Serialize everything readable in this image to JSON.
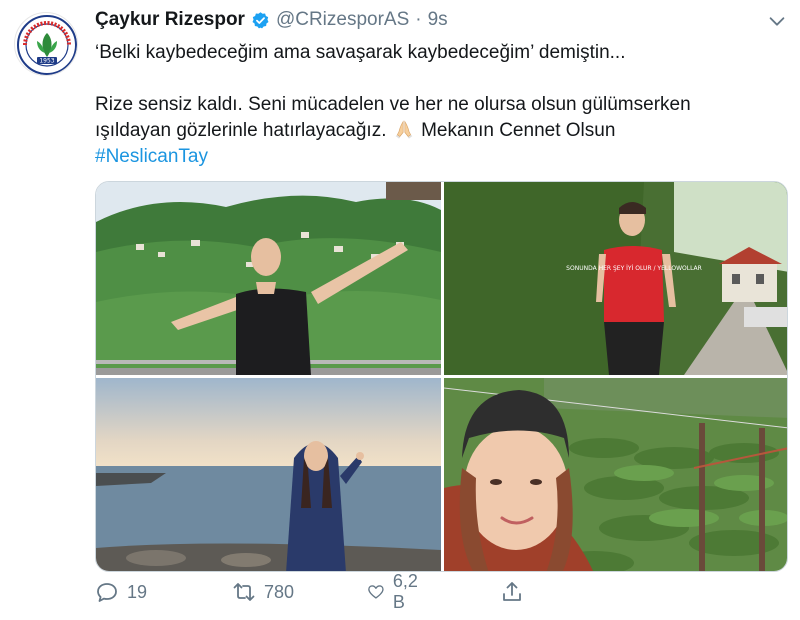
{
  "tweet": {
    "display_name": "Çaykur Rizespor",
    "handle": "@CRizesporAS",
    "separator": "·",
    "time": "9s",
    "line1": "‘Belki kaybedeceğim ama savaşarak kaybedeceğim’ demiştin...",
    "line2": "Rize sensiz kaldı. Seni mücadelen ve her ne olursa olsun gülümserken",
    "line3_text": "ışıldayan gözlerinle hatırlayacağız.",
    "line3_tail": "Mekanın Cennet Olsun",
    "hashtag": "#NeslicanTay",
    "emoji": "folded-hands-icon"
  },
  "avatar": {
    "logo_text_top": "ÇAYKUR RİZESPOR KULÜBÜ",
    "logo_year": "1953",
    "colors": {
      "green": "#2e8b3a",
      "blue": "#1f3c88",
      "red": "#d92b2b"
    }
  },
  "media": {
    "photos": [
      {
        "name": "photo-balcony-arms-open"
      },
      {
        "name": "photo-road-red-shirt",
        "shirt_text": "SONUNDA HER ŞEY İYİ OLUR / YELLOWOLLAR"
      },
      {
        "name": "photo-sea-hoodie"
      },
      {
        "name": "photo-selfie-tea-field"
      }
    ]
  },
  "actions": {
    "reply_count": "19",
    "retweet_count": "780",
    "like_count": "6,2 B"
  },
  "colors": {
    "accent": "#1b95e0",
    "verified": "#1da1f2",
    "muted": "#657786",
    "text": "#14171a"
  }
}
